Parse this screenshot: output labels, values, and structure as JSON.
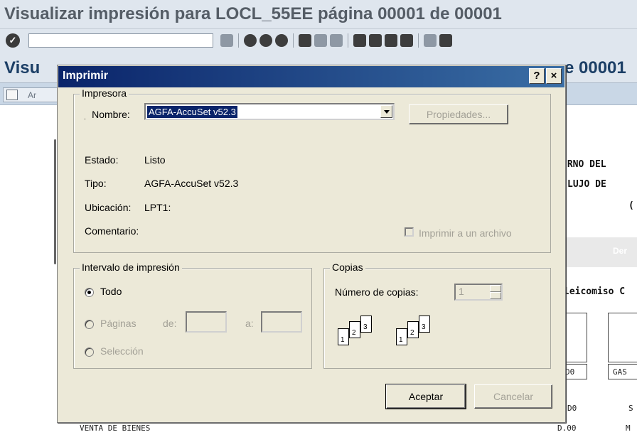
{
  "background": {
    "title": "Visualizar impresión para LOCL_55EE página 00001 de 00001",
    "title2_left": "Visu",
    "title2_right": "e 00001",
    "app_button_label": "Ar",
    "doc_lines": [
      "ERNO DEL",
      "LUJO DE",
      "(",
      "Der",
      "leicomiso C",
      "GAS",
      "D0",
      "S",
      "M",
      "VENTA DE BIENES",
      "D.00",
      "D0"
    ]
  },
  "dialog": {
    "title": "Imprimir",
    "help_label": "?",
    "close_label": "×",
    "printer_group": {
      "legend": "Impresora",
      "name_label": "Nombre:",
      "name_value": "AGFA-AccuSet v52.3",
      "properties_label": "Propiedades...",
      "status_label": "Estado:",
      "status_value": "Listo",
      "type_label": "Tipo:",
      "type_value": "AGFA-AccuSet v52.3",
      "location_label": "Ubicación:",
      "location_value": "LPT1:",
      "comment_label": "Comentario:",
      "print_to_file_label": "Imprimir a un archivo"
    },
    "range_group": {
      "legend": "Intervalo de impresión",
      "all_label": "Todo",
      "pages_label": "Páginas",
      "from_label": "de:",
      "to_label": "a:",
      "selection_label": "Selección"
    },
    "copies_group": {
      "legend": "Copias",
      "copies_label": "Número de copias:",
      "copies_value": "1",
      "collate_pages": [
        "1",
        "2",
        "3"
      ]
    },
    "ok_label": "Aceptar",
    "cancel_label": "Cancelar"
  }
}
